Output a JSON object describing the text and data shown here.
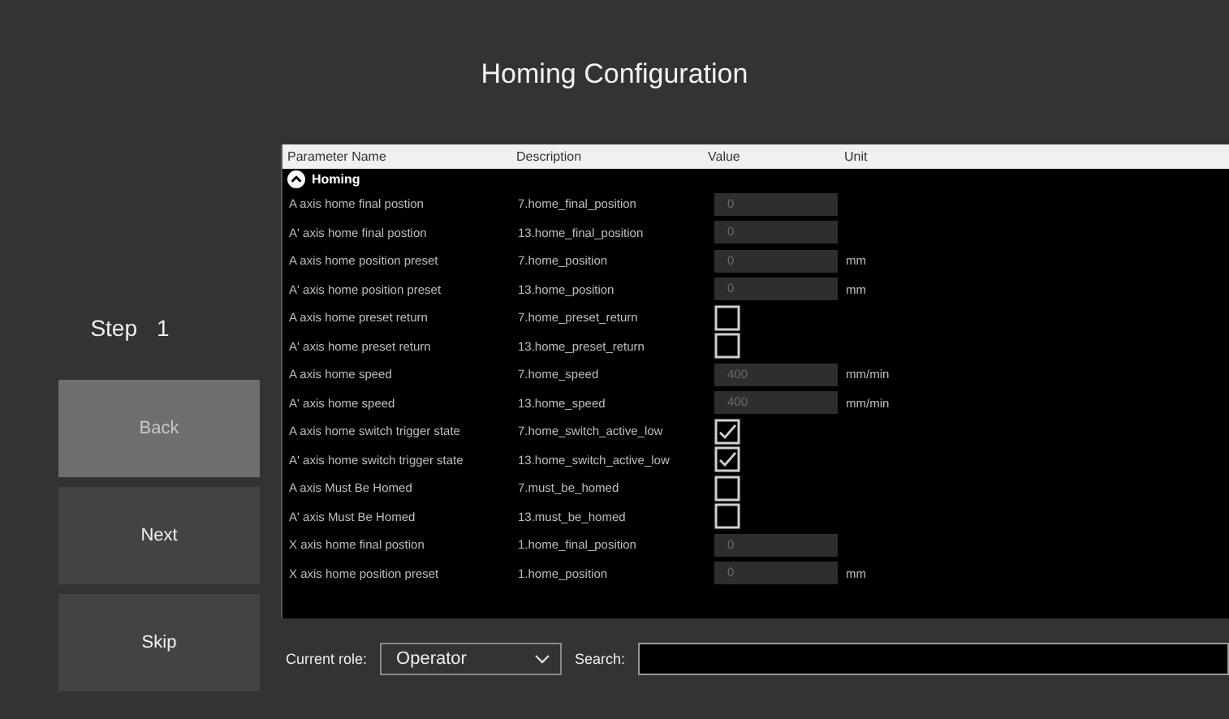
{
  "title": "Homing Configuration",
  "step": {
    "label": "Step",
    "number": "1"
  },
  "buttons": [
    {
      "label": "Back",
      "disabled": true
    },
    {
      "label": "Next",
      "disabled": false
    },
    {
      "label": "Skip",
      "disabled": false
    }
  ],
  "table": {
    "columns": [
      "Parameter Name",
      "Description",
      "Value",
      "Unit"
    ],
    "group": {
      "label": "Homing",
      "expanded": true
    },
    "rows": [
      {
        "name": "A axis home final postion",
        "description": "7.home_final_position",
        "kind": "number",
        "value": "0"
      },
      {
        "name": "A' axis home final postion",
        "description": "13.home_final_position",
        "kind": "number",
        "value": "0"
      },
      {
        "name": "A axis home position preset",
        "description": "7.home_position",
        "kind": "number",
        "value": "0",
        "unit": "mm"
      },
      {
        "name": "A' axis home position preset",
        "description": "13.home_position",
        "kind": "number",
        "value": "0",
        "unit": "mm"
      },
      {
        "name": "A axis home preset return",
        "description": "7.home_preset_return",
        "kind": "checkbox",
        "checked": false
      },
      {
        "name": "A' axis home preset return",
        "description": "13.home_preset_return",
        "kind": "checkbox",
        "checked": false
      },
      {
        "name": "A axis home speed",
        "description": "7.home_speed",
        "kind": "number",
        "value": "400",
        "unit": "mm/min"
      },
      {
        "name": "A' axis home speed",
        "description": "13.home_speed",
        "kind": "number",
        "value": "400",
        "unit": "mm/min"
      },
      {
        "name": "A axis home switch trigger state",
        "description": "7.home_switch_active_low",
        "kind": "checkbox",
        "checked": true
      },
      {
        "name": "A' axis home switch trigger state",
        "description": "13.home_switch_active_low",
        "kind": "checkbox",
        "checked": true
      },
      {
        "name": "A axis Must Be Homed",
        "description": "7.must_be_homed",
        "kind": "checkbox",
        "checked": false
      },
      {
        "name": "A' axis Must Be Homed",
        "description": "13.must_be_homed",
        "kind": "checkbox",
        "checked": false
      },
      {
        "name": "X axis home final postion",
        "description": "1.home_final_position",
        "kind": "number",
        "value": "0"
      },
      {
        "name": "X axis home position preset",
        "description": "1.home_position",
        "kind": "number",
        "value": "0",
        "unit": "mm"
      }
    ]
  },
  "footer": {
    "role_label": "Current role:",
    "role": "Operator",
    "search_label": "Search:"
  }
}
